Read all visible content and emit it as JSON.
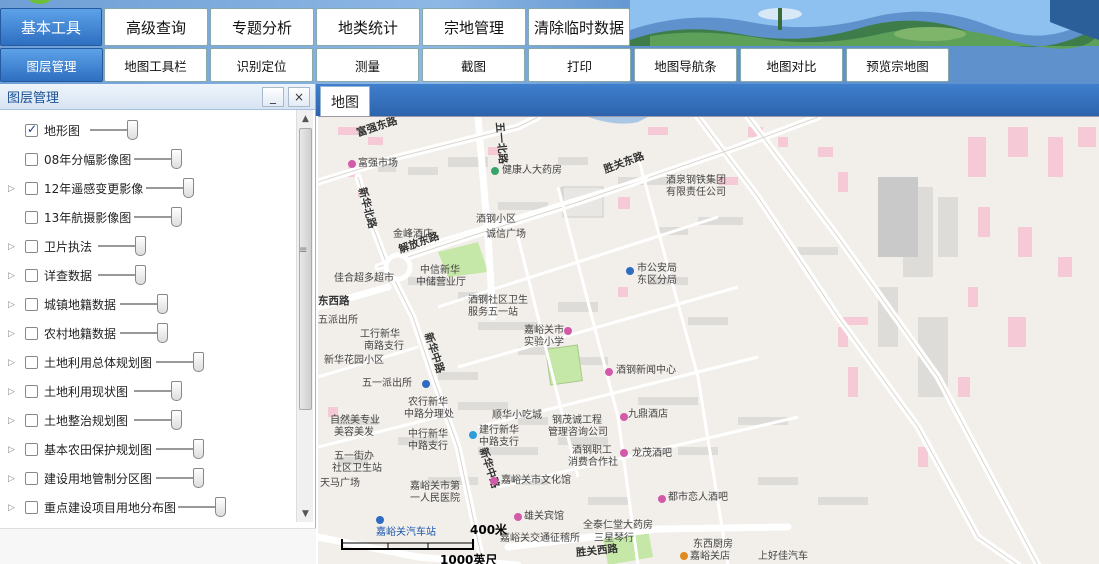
{
  "main_tabs": [
    "基本工具",
    "高级查询",
    "专题分析",
    "地类统计",
    "宗地管理",
    "清除临时数据"
  ],
  "sub_tabs": [
    "图层管理",
    "地图工具栏",
    "识别定位",
    "测量",
    "截图",
    "打印",
    "地图导航条",
    "地图对比",
    "预览宗地图"
  ],
  "panel": {
    "title": "图层管理",
    "minimize": "_",
    "close": "×",
    "layers": [
      {
        "name": "地形图",
        "checked": true,
        "expandable": false,
        "opacity": 1.0
      },
      {
        "name": "08年分幅影像图",
        "checked": false,
        "expandable": false,
        "opacity": 1.0
      },
      {
        "name": "12年遥感变更影像",
        "checked": false,
        "expandable": true,
        "opacity": 1.0
      },
      {
        "name": "13年航摄影像图",
        "checked": false,
        "expandable": false,
        "opacity": 1.0
      },
      {
        "name": "卫片执法",
        "checked": false,
        "expandable": true,
        "opacity": 1.0
      },
      {
        "name": "详查数据",
        "checked": false,
        "expandable": true,
        "opacity": 1.0
      },
      {
        "name": "城镇地籍数据",
        "checked": false,
        "expandable": true,
        "opacity": 1.0
      },
      {
        "name": "农村地籍数据",
        "checked": false,
        "expandable": true,
        "opacity": 1.0
      },
      {
        "name": "土地利用总体规划图",
        "checked": false,
        "expandable": true,
        "opacity": 1.0
      },
      {
        "name": "土地利用现状图",
        "checked": false,
        "expandable": true,
        "opacity": 1.0
      },
      {
        "name": "土地整治规划图",
        "checked": false,
        "expandable": true,
        "opacity": 1.0
      },
      {
        "name": "基本农田保护规划图",
        "checked": false,
        "expandable": true,
        "opacity": 1.0
      },
      {
        "name": "建设用地管制分区图",
        "checked": false,
        "expandable": true,
        "opacity": 1.0
      },
      {
        "name": "重点建设项目用地分布图",
        "checked": false,
        "expandable": true,
        "opacity": 1.0
      }
    ]
  },
  "map": {
    "tab_label": "地图",
    "scale_metric": "400米",
    "scale_imperial": "1000英尺",
    "roads": {
      "fuqiang": "富强东路",
      "wuyi": "五一北路",
      "xinhua_n": "新华北路",
      "shengguan": "胜关东路",
      "jiefang": "解放东路",
      "xinhua_z": "新华中路",
      "xinhua_z2": "新华中路",
      "xisheng": "胜关西路",
      "dongxi": "东西路"
    },
    "pois": {
      "fuqiang_market": "富强市场",
      "jiankang": "健康人大药房",
      "steel_group": "酒泉钢铁集团",
      "steel_group2": "有限责任公司",
      "jiuquan_xiaoqu": "酒钢小区",
      "chengxin": "诚信广场",
      "jinfeng": "金峰酒店",
      "xinhua_bank": "中信新华",
      "xinhua_bank2": "中储营业厅",
      "gongan": "市公安局",
      "gongan2": "东区分局",
      "jinfu": "佳合超多超市",
      "jiuquan_clinic": "酒钢社区卫生",
      "jiuquan_clinic2": "服务五一站",
      "paichusuo": "五派出所",
      "gongxin": "工行新华",
      "gongxin2": "南路支行",
      "jiayu_school": "嘉峪关市",
      "jiayu_school2": "实验小学",
      "huayuan": "新华花园小区",
      "jiuquan_news": "酒钢新闻中心",
      "wuyi_ps": "五一派出所",
      "nongxin": "农行新华",
      "nongxin2": "中路分理处",
      "meirong": "自然美专业",
      "meirong2": "美容美发",
      "zhongxin": "中行新华",
      "zhongxin2": "中路支行",
      "jianhang": "建行新华",
      "jianhang2": "中路支行",
      "xiaochi": "顺华小吃城",
      "gongcheng": "钢茂诚工程",
      "gongcheng2": "管理咨询公司",
      "binguan": "九鼎酒店",
      "zhigong": "酒钢职工",
      "zhigong2": "消费合作社",
      "longmao": "龙茂酒吧",
      "wuyi_wei": "五一街办",
      "wuyi_wei2": "社区卫生站",
      "shi_chang": "天马广场",
      "hospital": "嘉峪关市第",
      "hospital2": "一人民医院",
      "culture": "嘉峪关市文化馆",
      "zhixiang": "都市恋人酒吧",
      "yaofang": "全泰仁堂大药房",
      "sanxing": "三星琴行",
      "jiayuguan_bus": "嘉峪关汽车站",
      "traffic": "嘉峪关交通征稽所",
      "xiongguan": "雄关宾馆",
      "shop1": "东西厨房",
      "shop2": "嘉峪关店",
      "shangcheng": "上好佳汽车"
    }
  }
}
